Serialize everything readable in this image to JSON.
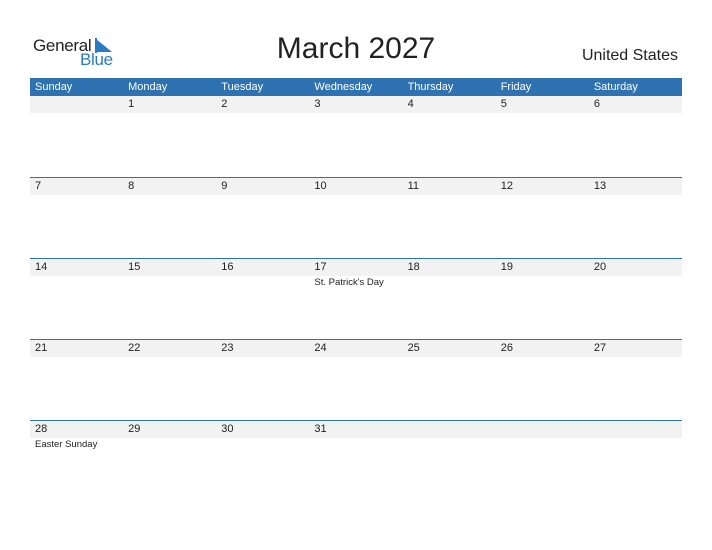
{
  "logo": {
    "general": "General",
    "blue": "Blue"
  },
  "title": "March 2027",
  "country": "United States",
  "weekdays": [
    "Sunday",
    "Monday",
    "Tuesday",
    "Wednesday",
    "Thursday",
    "Friday",
    "Saturday"
  ],
  "weeks": [
    {
      "days": [
        "",
        "1",
        "2",
        "3",
        "4",
        "5",
        "6"
      ],
      "events": [
        "",
        "",
        "",
        "",
        "",
        "",
        ""
      ]
    },
    {
      "days": [
        "7",
        "8",
        "9",
        "10",
        "11",
        "12",
        "13"
      ],
      "events": [
        "",
        "",
        "",
        "",
        "",
        "",
        ""
      ]
    },
    {
      "days": [
        "14",
        "15",
        "16",
        "17",
        "18",
        "19",
        "20"
      ],
      "events": [
        "",
        "",
        "",
        "St. Patrick's Day",
        "",
        "",
        ""
      ]
    },
    {
      "days": [
        "21",
        "22",
        "23",
        "24",
        "25",
        "26",
        "27"
      ],
      "events": [
        "",
        "",
        "",
        "",
        "",
        "",
        ""
      ]
    },
    {
      "days": [
        "28",
        "29",
        "30",
        "31",
        "",
        "",
        ""
      ],
      "events": [
        "Easter Sunday",
        "",
        "",
        "",
        "",
        "",
        ""
      ]
    }
  ],
  "colors": {
    "header": "#2e72b2",
    "accent": "#2a7bc4",
    "daybar": "#f2f2f2"
  }
}
